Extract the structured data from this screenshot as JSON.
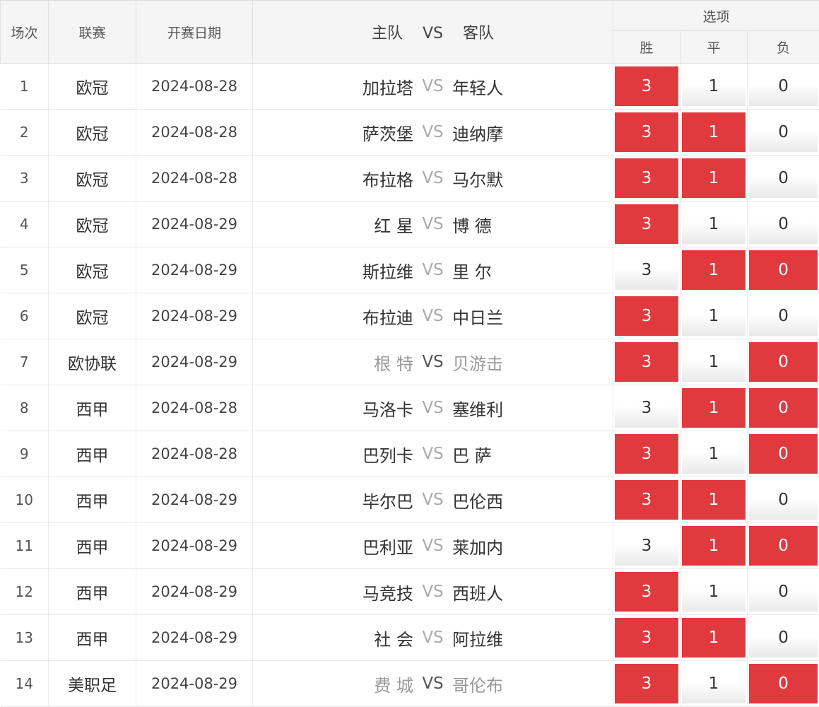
{
  "header": {
    "idx": "场次",
    "league": "联赛",
    "date": "开赛日期",
    "home_label": "主队",
    "vs": "VS",
    "away_label": "客队",
    "options_group": "选项",
    "win": "胜",
    "draw": "平",
    "lose": "负"
  },
  "accent_color": "#e13a3e",
  "rows": [
    {
      "idx": "1",
      "league": "欧冠",
      "date": "2024-08-28",
      "home": "加拉塔",
      "vs": "VS",
      "away": "年轻人",
      "muted": false,
      "win": "3",
      "draw": "1",
      "lose": "0",
      "sel": [
        true,
        false,
        false
      ]
    },
    {
      "idx": "2",
      "league": "欧冠",
      "date": "2024-08-28",
      "home": "萨茨堡",
      "vs": "VS",
      "away": "迪纳摩",
      "muted": false,
      "win": "3",
      "draw": "1",
      "lose": "0",
      "sel": [
        true,
        true,
        false
      ]
    },
    {
      "idx": "3",
      "league": "欧冠",
      "date": "2024-08-28",
      "home": "布拉格",
      "vs": "VS",
      "away": "马尔默",
      "muted": false,
      "win": "3",
      "draw": "1",
      "lose": "0",
      "sel": [
        true,
        true,
        false
      ]
    },
    {
      "idx": "4",
      "league": "欧冠",
      "date": "2024-08-29",
      "home": "红 星",
      "vs": "VS",
      "away": "博 德",
      "muted": false,
      "win": "3",
      "draw": "1",
      "lose": "0",
      "sel": [
        true,
        false,
        false
      ]
    },
    {
      "idx": "5",
      "league": "欧冠",
      "date": "2024-08-29",
      "home": "斯拉维",
      "vs": "VS",
      "away": "里 尔",
      "muted": false,
      "win": "3",
      "draw": "1",
      "lose": "0",
      "sel": [
        false,
        true,
        true
      ]
    },
    {
      "idx": "6",
      "league": "欧冠",
      "date": "2024-08-29",
      "home": "布拉迪",
      "vs": "VS",
      "away": "中日兰",
      "muted": false,
      "win": "3",
      "draw": "1",
      "lose": "0",
      "sel": [
        true,
        false,
        false
      ]
    },
    {
      "idx": "7",
      "league": "欧协联",
      "date": "2024-08-29",
      "home": "根 特",
      "vs": "VS",
      "away": "贝游击",
      "muted": true,
      "win": "3",
      "draw": "1",
      "lose": "0",
      "sel": [
        true,
        false,
        true
      ]
    },
    {
      "idx": "8",
      "league": "西甲",
      "date": "2024-08-28",
      "home": "马洛卡",
      "vs": "VS",
      "away": "塞维利",
      "muted": false,
      "win": "3",
      "draw": "1",
      "lose": "0",
      "sel": [
        false,
        true,
        true
      ]
    },
    {
      "idx": "9",
      "league": "西甲",
      "date": "2024-08-28",
      "home": "巴列卡",
      "vs": "VS",
      "away": "巴 萨",
      "muted": false,
      "win": "3",
      "draw": "1",
      "lose": "0",
      "sel": [
        true,
        false,
        true
      ]
    },
    {
      "idx": "10",
      "league": "西甲",
      "date": "2024-08-29",
      "home": "毕尔巴",
      "vs": "VS",
      "away": "巴伦西",
      "muted": false,
      "win": "3",
      "draw": "1",
      "lose": "0",
      "sel": [
        true,
        true,
        false
      ]
    },
    {
      "idx": "11",
      "league": "西甲",
      "date": "2024-08-29",
      "home": "巴利亚",
      "vs": "VS",
      "away": "莱加内",
      "muted": false,
      "win": "3",
      "draw": "1",
      "lose": "0",
      "sel": [
        false,
        true,
        true
      ]
    },
    {
      "idx": "12",
      "league": "西甲",
      "date": "2024-08-29",
      "home": "马竞技",
      "vs": "VS",
      "away": "西班人",
      "muted": false,
      "win": "3",
      "draw": "1",
      "lose": "0",
      "sel": [
        true,
        false,
        false
      ]
    },
    {
      "idx": "13",
      "league": "西甲",
      "date": "2024-08-29",
      "home": "社 会",
      "vs": "VS",
      "away": "阿拉维",
      "muted": false,
      "win": "3",
      "draw": "1",
      "lose": "0",
      "sel": [
        true,
        true,
        false
      ]
    },
    {
      "idx": "14",
      "league": "美职足",
      "date": "2024-08-29",
      "home": "费 城",
      "vs": "VS",
      "away": "哥伦布",
      "muted": true,
      "win": "3",
      "draw": "1",
      "lose": "0",
      "sel": [
        true,
        false,
        true
      ]
    }
  ]
}
